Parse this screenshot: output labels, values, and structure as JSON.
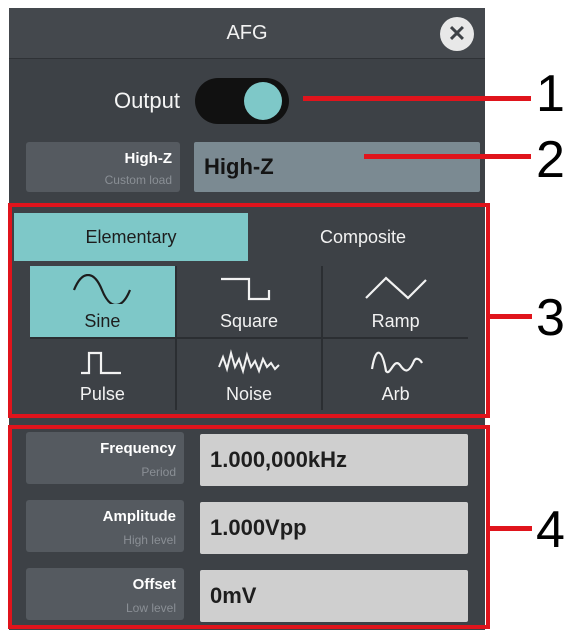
{
  "window": {
    "title": "AFG",
    "close_icon": "close-icon"
  },
  "output": {
    "label": "Output",
    "state": "on"
  },
  "load": {
    "button_main": "High-Z",
    "button_sub": "Custom load",
    "value": "High-Z"
  },
  "tabs": [
    {
      "label": "Elementary",
      "active": true
    },
    {
      "label": "Composite",
      "active": false
    }
  ],
  "waveforms": [
    {
      "label": "Sine",
      "icon": "sine-wave-icon",
      "active": true
    },
    {
      "label": "Square",
      "icon": "square-wave-icon",
      "active": false
    },
    {
      "label": "Ramp",
      "icon": "ramp-wave-icon",
      "active": false
    },
    {
      "label": "Pulse",
      "icon": "pulse-wave-icon",
      "active": false
    },
    {
      "label": "Noise",
      "icon": "noise-wave-icon",
      "active": false
    },
    {
      "label": "Arb",
      "icon": "arb-wave-icon",
      "active": false
    }
  ],
  "params": [
    {
      "main": "Frequency",
      "sub": "Period",
      "value": "1.000,000kHz"
    },
    {
      "main": "Amplitude",
      "sub": "High level",
      "value": "1.000Vpp"
    },
    {
      "main": "Offset",
      "sub": "Low level",
      "value": "0mV"
    }
  ],
  "callouts": [
    "1",
    "2",
    "3",
    "4"
  ],
  "colors": {
    "accent": "#7ec8c8",
    "panel": "#3d4146",
    "annotation_red": "#e0141c"
  }
}
